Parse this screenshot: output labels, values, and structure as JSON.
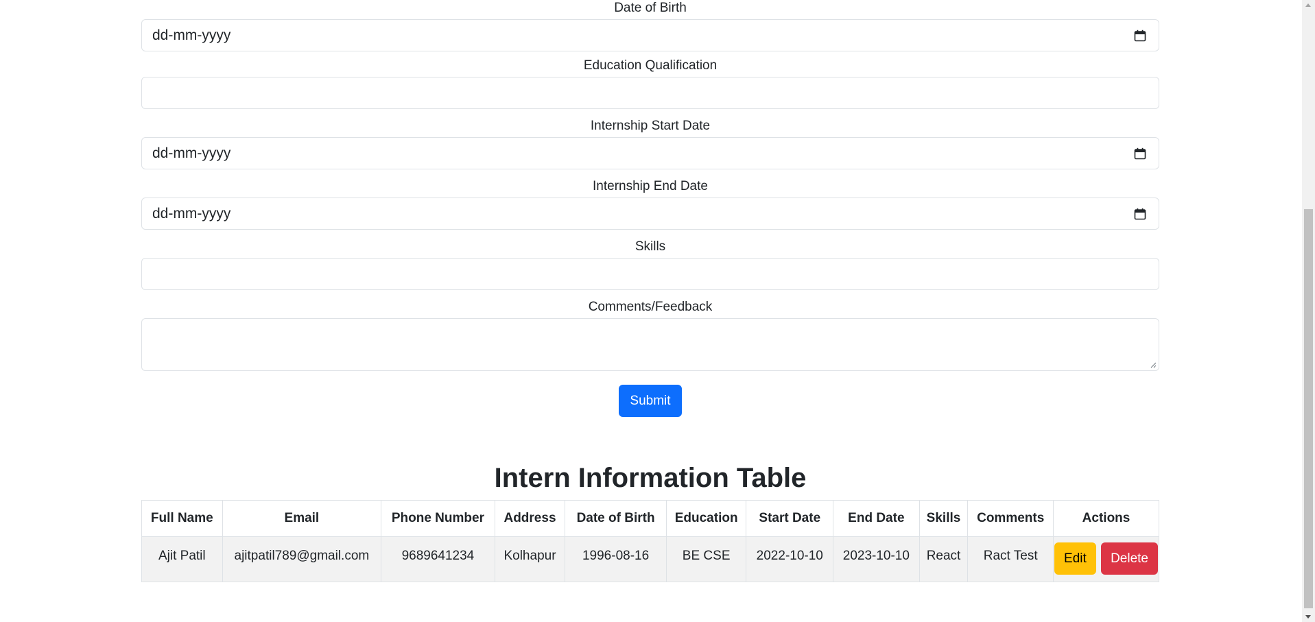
{
  "form": {
    "dob_label": "Date of Birth",
    "dob_placeholder": "dd-mm-yyyy",
    "education_label": "Education Qualification",
    "education_value": "",
    "start_label": "Internship Start Date",
    "start_placeholder": "dd-mm-yyyy",
    "end_label": "Internship End Date",
    "end_placeholder": "dd-mm-yyyy",
    "skills_label": "Skills",
    "skills_value": "",
    "comments_label": "Comments/Feedback",
    "comments_value": "",
    "submit_label": "Submit",
    "calendar_icon": "calendar-icon"
  },
  "table": {
    "title": "Intern Information Table",
    "headers": [
      "Full Name",
      "Email",
      "Phone Number",
      "Address",
      "Date of Birth",
      "Education",
      "Start Date",
      "End Date",
      "Skills",
      "Comments",
      "Actions"
    ],
    "rows": [
      {
        "full_name": "Ajit Patil",
        "email": "ajitpatil789@gmail.com",
        "phone": "9689641234",
        "address": "Kolhapur",
        "dob": "1996-08-16",
        "education": "BE CSE",
        "start_date": "2022-10-10",
        "end_date": "2023-10-10",
        "skills": "React",
        "comments": "Ract Test",
        "edit_label": "Edit",
        "delete_label": "Delete"
      }
    ]
  },
  "colors": {
    "primary": "#0d6efd",
    "warning": "#ffc107",
    "danger": "#dc3545",
    "row_bg": "#f2f2f2"
  }
}
